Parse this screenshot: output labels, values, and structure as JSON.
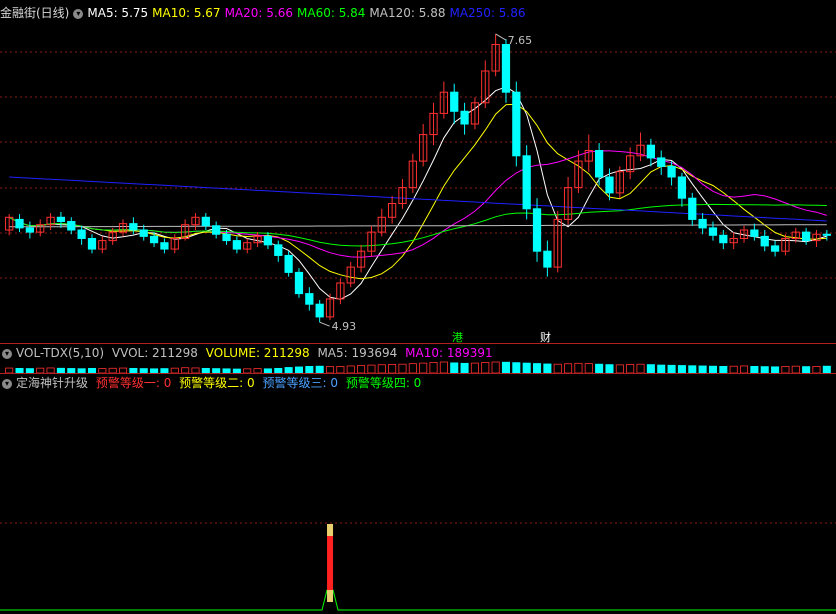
{
  "header": {
    "stock": "金融街(日线)",
    "ma": [
      {
        "label": "MA5: 5.75",
        "color": "#ffffff"
      },
      {
        "label": "MA10: 5.67",
        "color": "#ffff00"
      },
      {
        "label": "MA20: 5.66",
        "color": "#ff00ff"
      },
      {
        "label": "MA60: 5.84",
        "color": "#00ff00"
      },
      {
        "label": "MA120: 5.88",
        "color": "#c0c0c0"
      },
      {
        "label": "MA250: 5.86",
        "color": "#2020ff"
      }
    ]
  },
  "vol_header": {
    "name": "VOL-TDX(5,10)",
    "vvol": "VVOL: 211298",
    "volume": "VOLUME: 211298",
    "ma5": "MA5: 193694",
    "ma10": "MA10: 189391"
  },
  "ind_header": {
    "name": "定海神针升级",
    "lv1": "预警等级一: 0",
    "lv2": "预警等级二: 0",
    "lv3": "预警等级三: 0",
    "lv4": "预警等级四: 0"
  },
  "colors": {
    "up": "#ff3030",
    "down": "#00ffff",
    "grid": "#8b1a1a",
    "lv1": "#ff3030",
    "lv2": "#ffff00",
    "lv3": "#4aa0ff",
    "lv4": "#00ff00"
  },
  "markers": {
    "gang": "港",
    "cai": "财"
  },
  "chart_data": {
    "type": "candlestick",
    "price_range": [
      4.8,
      7.8
    ],
    "high_label": "7.65",
    "low_label": "4.93",
    "candles": [
      [
        5.8,
        5.92,
        5.95,
        5.75
      ],
      [
        5.9,
        5.82,
        5.95,
        5.78
      ],
      [
        5.82,
        5.78,
        5.88,
        5.72
      ],
      [
        5.78,
        5.85,
        5.9,
        5.74
      ],
      [
        5.85,
        5.92,
        5.96,
        5.8
      ],
      [
        5.92,
        5.88,
        5.97,
        5.82
      ],
      [
        5.88,
        5.8,
        5.92,
        5.76
      ],
      [
        5.8,
        5.72,
        5.84,
        5.66
      ],
      [
        5.72,
        5.62,
        5.76,
        5.58
      ],
      [
        5.62,
        5.7,
        5.74,
        5.58
      ],
      [
        5.7,
        5.78,
        5.82,
        5.66
      ],
      [
        5.78,
        5.86,
        5.9,
        5.74
      ],
      [
        5.86,
        5.8,
        5.92,
        5.76
      ],
      [
        5.8,
        5.74,
        5.85,
        5.7
      ],
      [
        5.74,
        5.68,
        5.78,
        5.64
      ],
      [
        5.68,
        5.62,
        5.72,
        5.58
      ],
      [
        5.62,
        5.72,
        5.76,
        5.58
      ],
      [
        5.72,
        5.85,
        5.9,
        5.7
      ],
      [
        5.85,
        5.92,
        5.96,
        5.8
      ],
      [
        5.92,
        5.84,
        5.96,
        5.8
      ],
      [
        5.84,
        5.76,
        5.88,
        5.72
      ],
      [
        5.76,
        5.7,
        5.8,
        5.66
      ],
      [
        5.7,
        5.62,
        5.74,
        5.58
      ],
      [
        5.62,
        5.68,
        5.72,
        5.58
      ],
      [
        5.68,
        5.74,
        5.78,
        5.64
      ],
      [
        5.74,
        5.66,
        5.78,
        5.62
      ],
      [
        5.66,
        5.56,
        5.7,
        5.5
      ],
      [
        5.56,
        5.4,
        5.6,
        5.36
      ],
      [
        5.4,
        5.2,
        5.44,
        5.16
      ],
      [
        5.2,
        5.1,
        5.26,
        5.04
      ],
      [
        5.1,
        4.98,
        5.14,
        4.93
      ],
      [
        4.98,
        5.15,
        5.2,
        4.95
      ],
      [
        5.15,
        5.3,
        5.34,
        5.1
      ],
      [
        5.3,
        5.45,
        5.5,
        5.26
      ],
      [
        5.45,
        5.6,
        5.66,
        5.4
      ],
      [
        5.6,
        5.78,
        5.84,
        5.55
      ],
      [
        5.78,
        5.92,
        6.0,
        5.74
      ],
      [
        5.92,
        6.05,
        6.12,
        5.86
      ],
      [
        6.05,
        6.2,
        6.28,
        6.0
      ],
      [
        6.2,
        6.45,
        6.52,
        6.15
      ],
      [
        6.45,
        6.7,
        6.8,
        6.4
      ],
      [
        6.7,
        6.9,
        7.0,
        6.6
      ],
      [
        6.9,
        7.1,
        7.2,
        6.85
      ],
      [
        7.1,
        6.92,
        7.18,
        6.8
      ],
      [
        6.92,
        6.8,
        7.0,
        6.7
      ],
      [
        6.8,
        7.0,
        7.05,
        6.75
      ],
      [
        7.0,
        7.3,
        7.4,
        6.95
      ],
      [
        7.3,
        7.55,
        7.65,
        7.25
      ],
      [
        7.55,
        7.1,
        7.6,
        7.0
      ],
      [
        7.1,
        6.5,
        7.2,
        6.4
      ],
      [
        6.5,
        6.0,
        6.6,
        5.9
      ],
      [
        6.0,
        5.6,
        6.1,
        5.5
      ],
      [
        5.6,
        5.45,
        5.7,
        5.36
      ],
      [
        5.45,
        5.9,
        5.98,
        5.4
      ],
      [
        5.9,
        6.2,
        6.3,
        5.85
      ],
      [
        6.2,
        6.45,
        6.55,
        6.15
      ],
      [
        6.45,
        6.55,
        6.7,
        6.35
      ],
      [
        6.55,
        6.3,
        6.62,
        6.22
      ],
      [
        6.3,
        6.15,
        6.38,
        6.08
      ],
      [
        6.15,
        6.35,
        6.4,
        6.1
      ],
      [
        6.35,
        6.5,
        6.58,
        6.28
      ],
      [
        6.5,
        6.6,
        6.72,
        6.45
      ],
      [
        6.6,
        6.48,
        6.66,
        6.4
      ],
      [
        6.48,
        6.4,
        6.55,
        6.32
      ],
      [
        6.4,
        6.3,
        6.45,
        6.22
      ],
      [
        6.3,
        6.1,
        6.34,
        6.02
      ],
      [
        6.1,
        5.9,
        6.15,
        5.84
      ],
      [
        5.9,
        5.82,
        5.96,
        5.76
      ],
      [
        5.82,
        5.75,
        5.88,
        5.7
      ],
      [
        5.75,
        5.68,
        5.8,
        5.62
      ],
      [
        5.68,
        5.72,
        5.78,
        5.62
      ],
      [
        5.72,
        5.8,
        5.84,
        5.68
      ],
      [
        5.8,
        5.74,
        5.86,
        5.7
      ],
      [
        5.74,
        5.65,
        5.8,
        5.6
      ],
      [
        5.65,
        5.6,
        5.7,
        5.55
      ],
      [
        5.6,
        5.72,
        5.76,
        5.56
      ],
      [
        5.72,
        5.78,
        5.82,
        5.68
      ],
      [
        5.78,
        5.7,
        5.82,
        5.66
      ],
      [
        5.7,
        5.76,
        5.8,
        5.64
      ],
      [
        5.76,
        5.75,
        5.8,
        5.7
      ]
    ],
    "volume": [
      0.45,
      0.42,
      0.4,
      0.44,
      0.46,
      0.43,
      0.41,
      0.39,
      0.42,
      0.4,
      0.43,
      0.45,
      0.42,
      0.4,
      0.38,
      0.4,
      0.44,
      0.48,
      0.46,
      0.42,
      0.4,
      0.38,
      0.36,
      0.38,
      0.4,
      0.38,
      0.42,
      0.5,
      0.55,
      0.6,
      0.62,
      0.58,
      0.6,
      0.64,
      0.68,
      0.72,
      0.75,
      0.78,
      0.8,
      0.85,
      0.9,
      0.95,
      1.0,
      0.92,
      0.88,
      0.9,
      0.96,
      1.0,
      0.98,
      0.94,
      0.9,
      0.86,
      0.82,
      0.8,
      0.84,
      0.88,
      0.86,
      0.8,
      0.76,
      0.74,
      0.78,
      0.8,
      0.76,
      0.72,
      0.7,
      0.68,
      0.66,
      0.64,
      0.62,
      0.6,
      0.62,
      0.64,
      0.6,
      0.58,
      0.56,
      0.6,
      0.62,
      0.58,
      0.6,
      0.62
    ],
    "signal_index": 31
  }
}
